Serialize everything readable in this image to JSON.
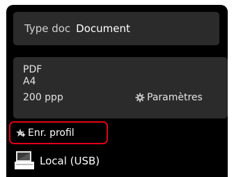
{
  "doc_type": {
    "label": "Type doc",
    "value": "Document"
  },
  "settings": {
    "format": "PDF",
    "paper_size": "A4",
    "resolution": "200 ppp",
    "params_label": "Paramètres",
    "params_icon": "gear-icon"
  },
  "save_profile": {
    "label": "Enr. profil",
    "icon": "star-icon"
  },
  "destination": {
    "label": "Local (USB)",
    "icon": "computer-icon"
  },
  "colors": {
    "screen_bg": "#000000",
    "panel_bg": "#2b2b2b",
    "highlight_border": "#e0001a"
  }
}
